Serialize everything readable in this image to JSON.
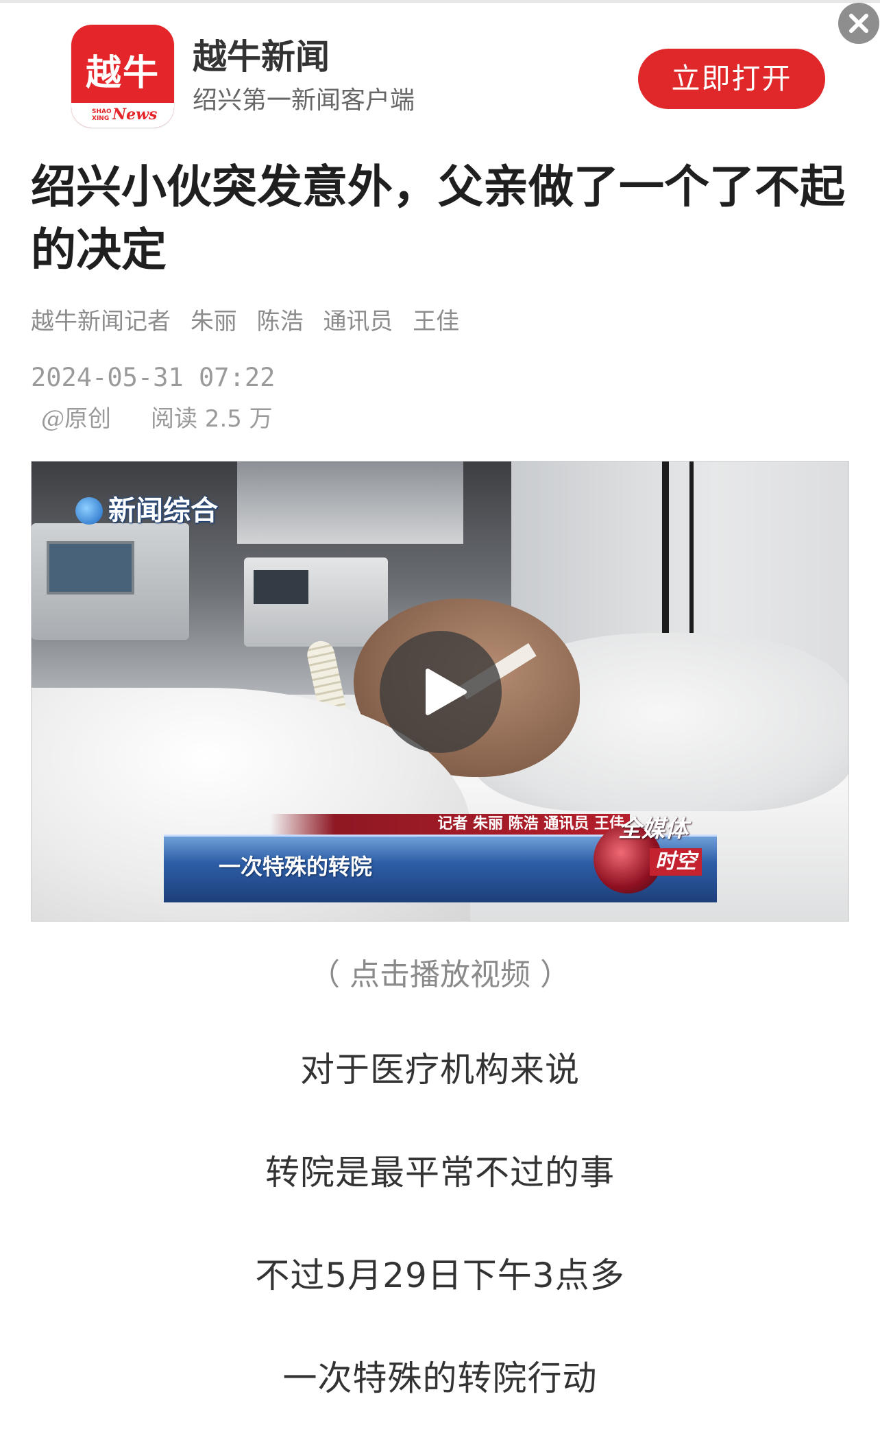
{
  "banner": {
    "logo_text": "越牛",
    "logo_small": "SHAO XING",
    "logo_news": "News",
    "app_name": "越牛新闻",
    "tagline": "绍兴第一新闻客户端",
    "open_button": "立即打开",
    "close_icon": "close-icon"
  },
  "article": {
    "title": "绍兴小伙突发意外，父亲做了一个了不起的决定",
    "byline": [
      "越牛新闻记者",
      "朱丽",
      "陈浩",
      "通讯员",
      "王佳"
    ],
    "timestamp": "2024-05-31 07:22",
    "original_mark": "@",
    "original_label": "原创",
    "reads_label": "阅读 2.5 万"
  },
  "video": {
    "channel": "新闻综合",
    "reporter_line": "记者 朱丽 陈浩 通讯员 王佳",
    "caption": "一次特殊的转院",
    "badge_title": "全媒体",
    "badge_sub": "时空",
    "play_icon": "play-icon",
    "note": "（ 点击播放视频 ）"
  },
  "paragraphs": [
    "对于医疗机构来说",
    "转院是最平常不过的事",
    "不过5月29日下午3点多",
    "一次特殊的转院行动"
  ],
  "colors": {
    "brand_red": "#e0282a",
    "title_text": "#1f1f1f",
    "meta_gray": "#9a9a9a"
  }
}
